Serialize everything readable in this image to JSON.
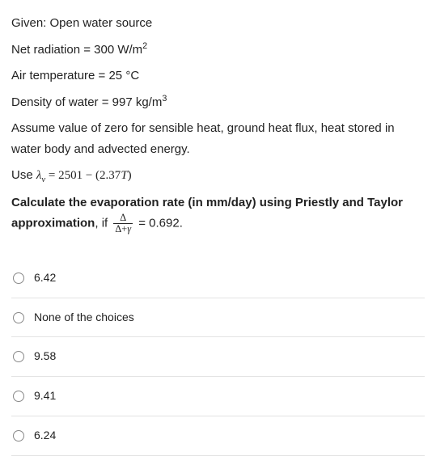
{
  "question": {
    "line1": "Given: Open water source",
    "line2_prefix": "Net radiation = 300 W/m",
    "line2_exp": "2",
    "line3": "Air temperature = 25 °C",
    "line4_prefix": "Density of water = 997 kg/m",
    "line4_exp": "3",
    "line5": "Assume value of zero for sensible heat, ground heat flux, heat stored in water body and advected energy.",
    "line6_use": "Use ",
    "line6_lambda": "λ",
    "line6_sub": "v",
    "line6_eq": " = 2501 − (2.37",
    "line6_T": "T",
    "line6_close": ")",
    "line7_bold": "Calculate the evaporation rate (in mm/day) using Priestly and Taylor approximation",
    "line7_if": ", if ",
    "line7_num": "Δ",
    "line7_den_a": "Δ+",
    "line7_den_b": "γ",
    "line7_val": " = 0.692."
  },
  "options": [
    {
      "label": "6.42"
    },
    {
      "label": "None of the choices"
    },
    {
      "label": "9.58"
    },
    {
      "label": "9.41"
    },
    {
      "label": "6.24"
    }
  ]
}
